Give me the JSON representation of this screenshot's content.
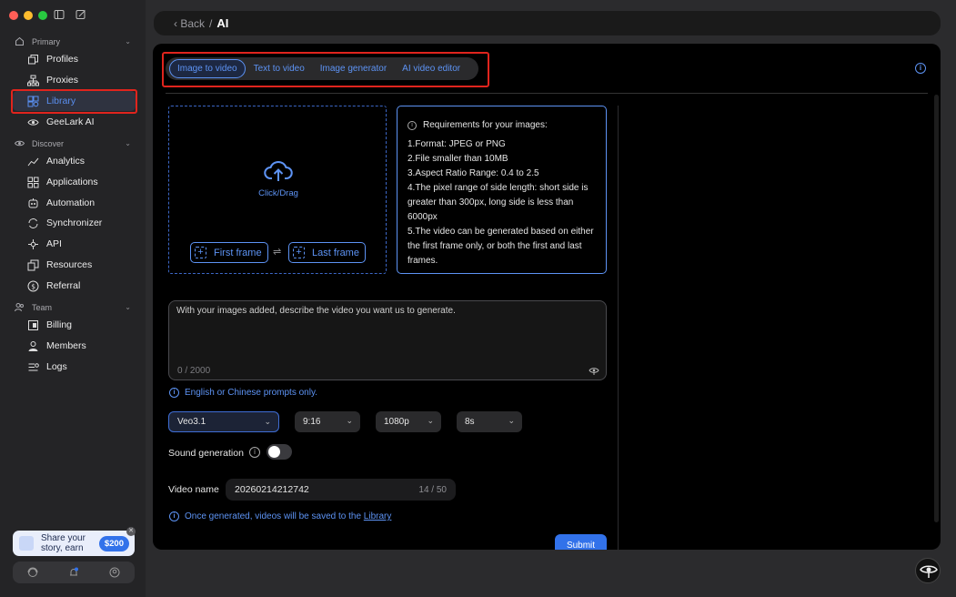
{
  "sidebar": {
    "primary_label": "Primary",
    "discover_label": "Discover",
    "team_label": "Team",
    "items": [
      {
        "label": "Profiles"
      },
      {
        "label": "Proxies"
      },
      {
        "label": "Library"
      },
      {
        "label": "GeeLark AI"
      },
      {
        "label": "Analytics"
      },
      {
        "label": "Applications"
      },
      {
        "label": "Automation"
      },
      {
        "label": "Synchronizer"
      },
      {
        "label": "API"
      },
      {
        "label": "Resources"
      },
      {
        "label": "Referral"
      },
      {
        "label": "Billing"
      },
      {
        "label": "Members"
      },
      {
        "label": "Logs"
      }
    ],
    "promo": {
      "line1": "Share your",
      "line2": "story, earn",
      "badge": "$200"
    }
  },
  "header": {
    "back": "Back",
    "separator": "/",
    "title": "AI"
  },
  "tabs": [
    {
      "label": "Image to video"
    },
    {
      "label": "Text to video"
    },
    {
      "label": "Image generator"
    },
    {
      "label": "AI video editor"
    }
  ],
  "upload": {
    "label": "Click/Drag",
    "first_frame": "First frame",
    "last_frame": "Last frame",
    "swap": "⇌"
  },
  "requirements": {
    "title": "Requirements for your images:",
    "items": [
      "1.Format: JPEG or PNG",
      "2.File smaller than 10MB",
      "3.Aspect Ratio Range: 0.4 to 2.5",
      "4.The pixel range of side length: short side is greater than 300px, long side is less than 6000px",
      "5.The video can be generated based on either the first frame only, or both the first and last frames."
    ]
  },
  "prompt": {
    "placeholder": "With your images added, describe the video you want us to generate.",
    "count": "0 / 2000"
  },
  "notes": {
    "language": "English or Chinese prompts only.",
    "saved_prefix": "Once generated, videos will be saved to the",
    "saved_link": "Library"
  },
  "options": {
    "model": "Veo3.1",
    "ratio": "9:16",
    "resolution": "1080p",
    "duration": "8s"
  },
  "sound": {
    "label": "Sound generation",
    "enabled": false
  },
  "video_name": {
    "label": "Video name",
    "value": "20260214212742",
    "count": "14 / 50"
  },
  "submit_label": "Submit",
  "colors": {
    "accent": "#3272ea",
    "link": "#5d93f4",
    "highlight": "#e0241d"
  }
}
